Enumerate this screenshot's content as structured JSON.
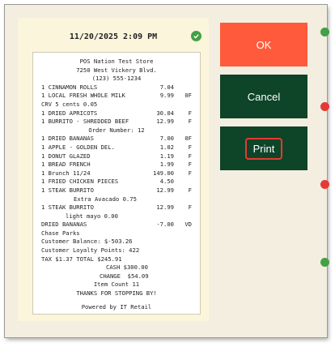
{
  "header": {
    "datetime": "11/20/2025 2:09 PM"
  },
  "receipt": {
    "store_name": "POS Nation Test Store",
    "address": "7250 West Vickery Blvd.",
    "phone": "(123) 555-1234",
    "lines": [
      {
        "desc": "1 CINNAMON ROLLS",
        "price": "7.04",
        "flag": ""
      },
      {
        "desc": "1 LOCAL FRESH WHOLE MILK",
        "price": "9.99",
        "flag": "0F"
      },
      {
        "desc": "CRV 5 cents 0.05",
        "price": "",
        "flag": ""
      },
      {
        "desc": "1 DRIED APRICOTS",
        "price": "30.04",
        "flag": "F"
      },
      {
        "desc": "1 BURRITO - SHREDDED BEEF",
        "price": "12.99",
        "flag": "F"
      }
    ],
    "order_number": "Order Number: 12",
    "lines2": [
      {
        "desc": "1 DRIED BANANAS",
        "price": "7.00",
        "flag": "0F"
      },
      {
        "desc": "1 APPLE - GOLDEN DEL.",
        "price": "1.02",
        "flag": "F"
      },
      {
        "desc": "1 DONUT GLAZED",
        "price": "1.19",
        "flag": "F"
      },
      {
        "desc": "1 BREAD FRENCH",
        "price": "1.99",
        "flag": "F"
      },
      {
        "desc": "1 Brunch 11/24",
        "price": "149.00",
        "flag": "F"
      },
      {
        "desc": "1 FRIED CHICKEN PIECES",
        "price": "4.50",
        "flag": ""
      },
      {
        "desc": "1 STEAK BURRITO",
        "price": "12.99",
        "flag": "F"
      }
    ],
    "modifier1": "Extra Avacado 0.75",
    "line_steak2": {
      "desc": "1 STEAK BURRITO",
      "price": "12.99",
      "flag": "F"
    },
    "modifier2": "light mayo 0.00",
    "void_line": {
      "desc": "DRIED BANANAS",
      "price": "-7.00",
      "flag": "VD"
    },
    "customer": "Chase Parks",
    "balance": "Customer Balance: $-503.26",
    "loyalty": "Customer Loyalty Points: 422",
    "tax_total": "TAX $1.37 TOTAL $245.91",
    "cash": "CASH $300.00",
    "change": "CHANGE  $54.09",
    "item_count": "Item Count 11",
    "thanks": "THANKS FOR STOPPING BY!",
    "powered": "Powered by IT Retail"
  },
  "buttons": {
    "ok": "OK",
    "cancel": "Cancel",
    "print": "Print"
  },
  "colors": {
    "ok": "#ff5a3c",
    "dark_green": "#0e4428",
    "highlight": "#e53935",
    "panel": "#fbf5dc",
    "check": "#43a047"
  },
  "icons": {
    "status": "check-circle-icon"
  }
}
